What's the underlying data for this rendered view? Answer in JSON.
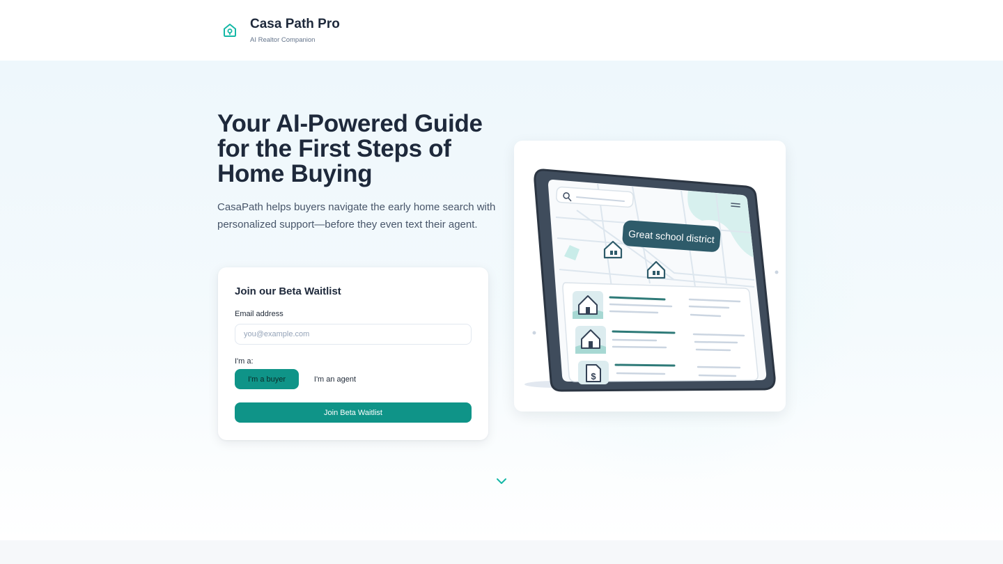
{
  "header": {
    "brand_name": "Casa Path Pro",
    "brand_tagline": "AI Realtor Companion",
    "logo_icon": "house-pin-icon"
  },
  "hero": {
    "title": "Your AI-Powered Guide for the First Steps of Home Buying",
    "subtitle": "CasaPath helps buyers navigate the early home search with personalized support—before they even text their agent."
  },
  "waitlist": {
    "title": "Join our Beta Waitlist",
    "email_label": "Email address",
    "email_value": "",
    "email_placeholder": "you@example.com",
    "role_label": "I'm a:",
    "role_options": [
      "I'm a buyer",
      "I'm an agent"
    ],
    "role_selected": "I'm a buyer",
    "submit_label": "Join Beta Waitlist"
  },
  "illustration": {
    "map_tooltip": "Great school district",
    "icons": [
      "search-icon",
      "menu-icon",
      "house-icon",
      "dollar-document-icon"
    ]
  },
  "colors": {
    "accent": "#0f9488",
    "heading": "#1e293b",
    "body": "#475569",
    "hero_bg": "#eef7fc"
  },
  "scroll_indicator": "chevron-down-icon"
}
